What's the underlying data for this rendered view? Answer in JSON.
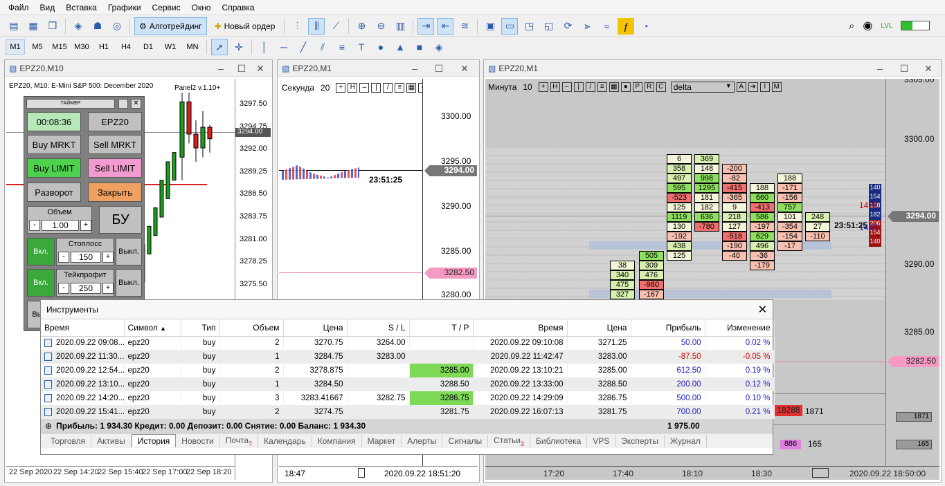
{
  "menu": [
    "Файл",
    "Вид",
    "Вставка",
    "Графики",
    "Сервис",
    "Окно",
    "Справка"
  ],
  "toolbar": {
    "algo_label": "Алготрейдинг",
    "new_order_label": "Новый ордер"
  },
  "timeframes": [
    "M1",
    "M5",
    "M15",
    "M30",
    "H1",
    "H4",
    "D1",
    "W1",
    "MN"
  ],
  "chart1": {
    "title": "EPZ20,M10",
    "info": "EPZ20, M10:  E-Mini S&P 500: December 2020",
    "panel_version": "Panel2 v.1.10+",
    "prices": [
      "3297.50",
      "3294.75",
      "3292.00",
      "3289.25",
      "3286.50",
      "3283.75",
      "3281.00",
      "3278.25",
      "3275.50"
    ],
    "current_price": "3294.00",
    "xaxis": [
      "22 Sep 2020",
      "22 Sep 14:20",
      "22 Sep 15:40",
      "22 Sep 17:00",
      "22 Sep 18:20"
    ],
    "candles": [
      {
        "o": 3291.5,
        "h": 3298.5,
        "l": 3289.0,
        "c": 3297.5
      },
      {
        "o": 3297.5,
        "h": 3298.5,
        "l": 3293.0,
        "c": 3294.0
      },
      {
        "o": 3294.0,
        "h": 3295.5,
        "l": 3291.0,
        "c": 3292.5
      },
      {
        "o": 3292.5,
        "h": 3296.5,
        "l": 3291.5,
        "c": 3294.75
      },
      {
        "o": 3294.75,
        "h": 3295.0,
        "l": 3292.0,
        "c": 3293.5
      }
    ]
  },
  "panel": {
    "timer_caption": "ТАЙМЕР",
    "timer": "00:08:36",
    "symbol": "EPZ20",
    "buy_mrkt": "Buy MRKT",
    "sell_mrkt": "Sell MRKT",
    "buy_limit": "Buy LIMIT",
    "sell_limit": "Sell LIMIT",
    "reverse": "Разворот",
    "close": "Закрыть",
    "volume_label": "Объем",
    "volume": "1.00",
    "minus": "-",
    "plus": "+",
    "bu": "БУ",
    "on": "Вкл.",
    "off": "Выкл.",
    "stoploss_label": "Стоплосс",
    "stoploss": "150",
    "takeprofit_label": "Тейкпрофит",
    "takeprofit": "250",
    "last_btn": "Вы"
  },
  "chart2": {
    "title": "EPZ20,M1",
    "mode": "Секунда",
    "mode_val": "20",
    "prices": [
      "3300.00",
      "3295.00",
      "3290.00",
      "3285.00",
      "3280.00"
    ],
    "current_price": "3294.00",
    "stop_price": "3282.50",
    "clock": "23:51:25",
    "status_left": "18:47",
    "status_right": "2020.09.22 18:51:20"
  },
  "chart3": {
    "title": "EPZ20,M1",
    "mode": "Минута",
    "mode_val": "10",
    "indicator": "delta",
    "prices": [
      "3305.00",
      "3300.00",
      "3295.00",
      "3290.00",
      "3285.00"
    ],
    "current_price": "3294.00",
    "stop_price": "3282.50",
    "clock": "23:51:25",
    "side_top": "1428",
    "side_bottom": "1467",
    "right_vals": [
      "140",
      "154",
      "168",
      "182",
      "206",
      "154",
      "140"
    ],
    "lower_vals": [
      "18288",
      "1871",
      "886",
      "165"
    ],
    "scale_lower": [
      "1871",
      "165"
    ],
    "xaxis": [
      "17:20",
      "17:40",
      "18:10",
      "18:30"
    ],
    "status_right": "2020.09.22 18:50:00",
    "col1": [
      "6",
      "358",
      "497",
      "595",
      "-523",
      "125",
      "1119",
      "130",
      "-192",
      "438",
      "125"
    ],
    "col2": [
      "369",
      "148",
      "998",
      "1295",
      "181",
      "182",
      "636",
      "-780"
    ],
    "col3": [
      "-200",
      "-82",
      "-415",
      "-365",
      "9",
      "218",
      "127",
      "-518",
      "-190",
      "-40"
    ],
    "col4": [
      "188",
      "660",
      "-413",
      "586",
      "-197",
      "629",
      "496",
      "-36",
      "-179"
    ],
    "col5": [
      "188",
      "-171",
      "-156",
      "757",
      "101",
      "-354",
      "-154",
      "-17"
    ],
    "col6": [
      "248",
      "27",
      "-110"
    ],
    "col0": [
      "505",
      "309",
      "476",
      "-980",
      "-167"
    ],
    "colm": [
      "38",
      "340",
      "475",
      "327"
    ]
  },
  "tools": {
    "title": "Инструменты",
    "columns": [
      "Время",
      "Символ",
      "Тип",
      "Объем",
      "Цена",
      "S / L",
      "T / P",
      "Время",
      "Цена",
      "Прибыль",
      "Изменение"
    ],
    "rows": [
      [
        "2020.09.22 09:08...",
        "epz20",
        "buy",
        "2",
        "3270.75",
        "3264.00",
        "",
        "2020.09.22 09:10:08",
        "3271.25",
        "50.00",
        "0.02 %"
      ],
      [
        "2020.09.22 11:30...",
        "epz20",
        "buy",
        "1",
        "3284.75",
        "3283.00",
        "",
        "2020.09.22 11:42:47",
        "3283.00",
        "-87.50",
        "-0.05 %"
      ],
      [
        "2020.09.22 12:54...",
        "epz20",
        "buy",
        "2",
        "3278.875",
        "",
        "3285.00",
        "2020.09.22 13:10:21",
        "3285.00",
        "612.50",
        "0.19 %"
      ],
      [
        "2020.09.22 13:10...",
        "epz20",
        "buy",
        "1",
        "3284.50",
        "",
        "3288.50",
        "2020.09.22 13:33:00",
        "3288.50",
        "200.00",
        "0.12 %"
      ],
      [
        "2020.09.22 14:20...",
        "epz20",
        "buy",
        "3",
        "3283.41667",
        "3282.75",
        "3286.75",
        "2020.09.22 14:29:09",
        "3286.75",
        "500.00",
        "0.10 %"
      ],
      [
        "2020.09.22 15:41...",
        "epz20",
        "buy",
        "2",
        "3274.75",
        "",
        "3281.75",
        "2020.09.22 16:07:13",
        "3281.75",
        "700.00",
        "0.21 %"
      ]
    ],
    "summary": "Прибыль: 1 934.30  Кредит: 0.00  Депозит: 0.00  Снятие: 0.00  Баланс: 1 934.30",
    "summary_total": "1 975.00",
    "tabs": [
      "Торговля",
      "Активы",
      "История",
      "Новости",
      "Почта",
      "Календарь",
      "Компания",
      "Маркет",
      "Алерты",
      "Сигналы",
      "Статьи",
      "Библиотека",
      "VPS",
      "Эксперты",
      "Журнал"
    ],
    "mail_count": "7",
    "articles_count": "3"
  }
}
